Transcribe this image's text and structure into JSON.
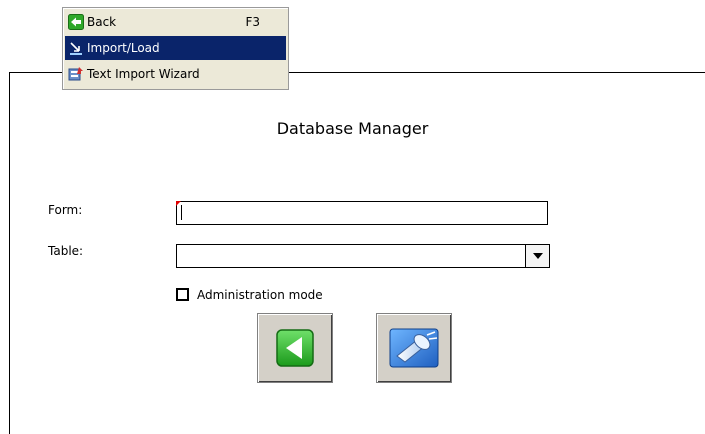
{
  "menu": {
    "items": [
      {
        "label": "Back",
        "shortcut": "F3",
        "icon": "green-back-arrow-icon"
      },
      {
        "label": "Import/Load",
        "shortcut": "",
        "icon": "import-load-icon"
      },
      {
        "label": "Text Import Wizard",
        "shortcut": "",
        "icon": "text-import-wizard-icon"
      }
    ],
    "highlight_color": "#0a246a"
  },
  "title": "Database Manager",
  "form": {
    "form_label": "Form:",
    "form_value": "",
    "table_label": "Table:",
    "table_value": "",
    "admin_mode_label": "Administration mode",
    "admin_mode_checked": false
  },
  "buttons": {
    "back_icon": "green-back-arrow-icon",
    "search_icon": "flashlight-icon"
  }
}
